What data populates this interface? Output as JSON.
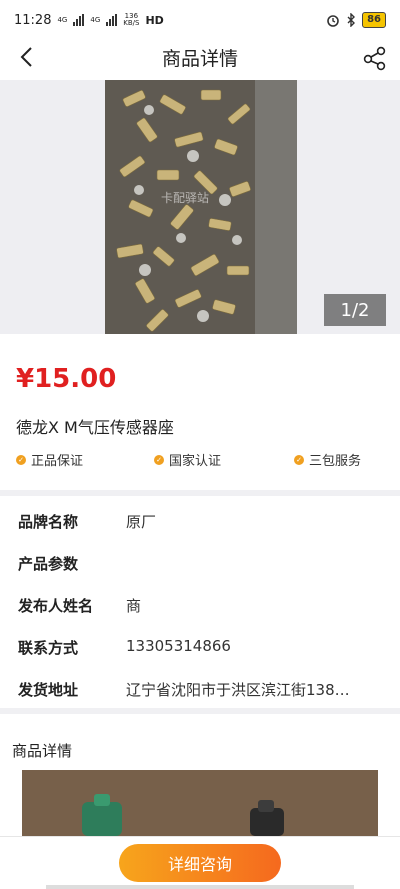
{
  "status_bar": {
    "time": "11:28",
    "net1": "4G",
    "net2": "4G",
    "speed_value": "136",
    "speed_unit": "KB/S",
    "hd": "HD",
    "battery": "86"
  },
  "nav": {
    "title": "商品详情"
  },
  "gallery": {
    "counter": "1/2",
    "watermark": "卡配驿站"
  },
  "product": {
    "price": "¥15.00",
    "title": "德龙X M气压传感器座"
  },
  "badges": [
    {
      "label": "正品保证"
    },
    {
      "label": "国家认证"
    },
    {
      "label": "三包服务"
    }
  ],
  "attributes": [
    {
      "key": "品牌名称",
      "value": "原厂"
    },
    {
      "key": "产品参数",
      "value": ""
    },
    {
      "key": "发布人姓名",
      "value": "商"
    },
    {
      "key": "联系方式",
      "value": "13305314866"
    },
    {
      "key": "发货地址",
      "value": "辽宁省沈阳市于洪区滨江街138…"
    }
  ],
  "detail": {
    "section_title": "商品详情"
  },
  "bottom": {
    "consult_label": "详细咨询"
  },
  "colors": {
    "price": "#e02020",
    "accent": "#f5691e",
    "badge": "#f0a020"
  }
}
